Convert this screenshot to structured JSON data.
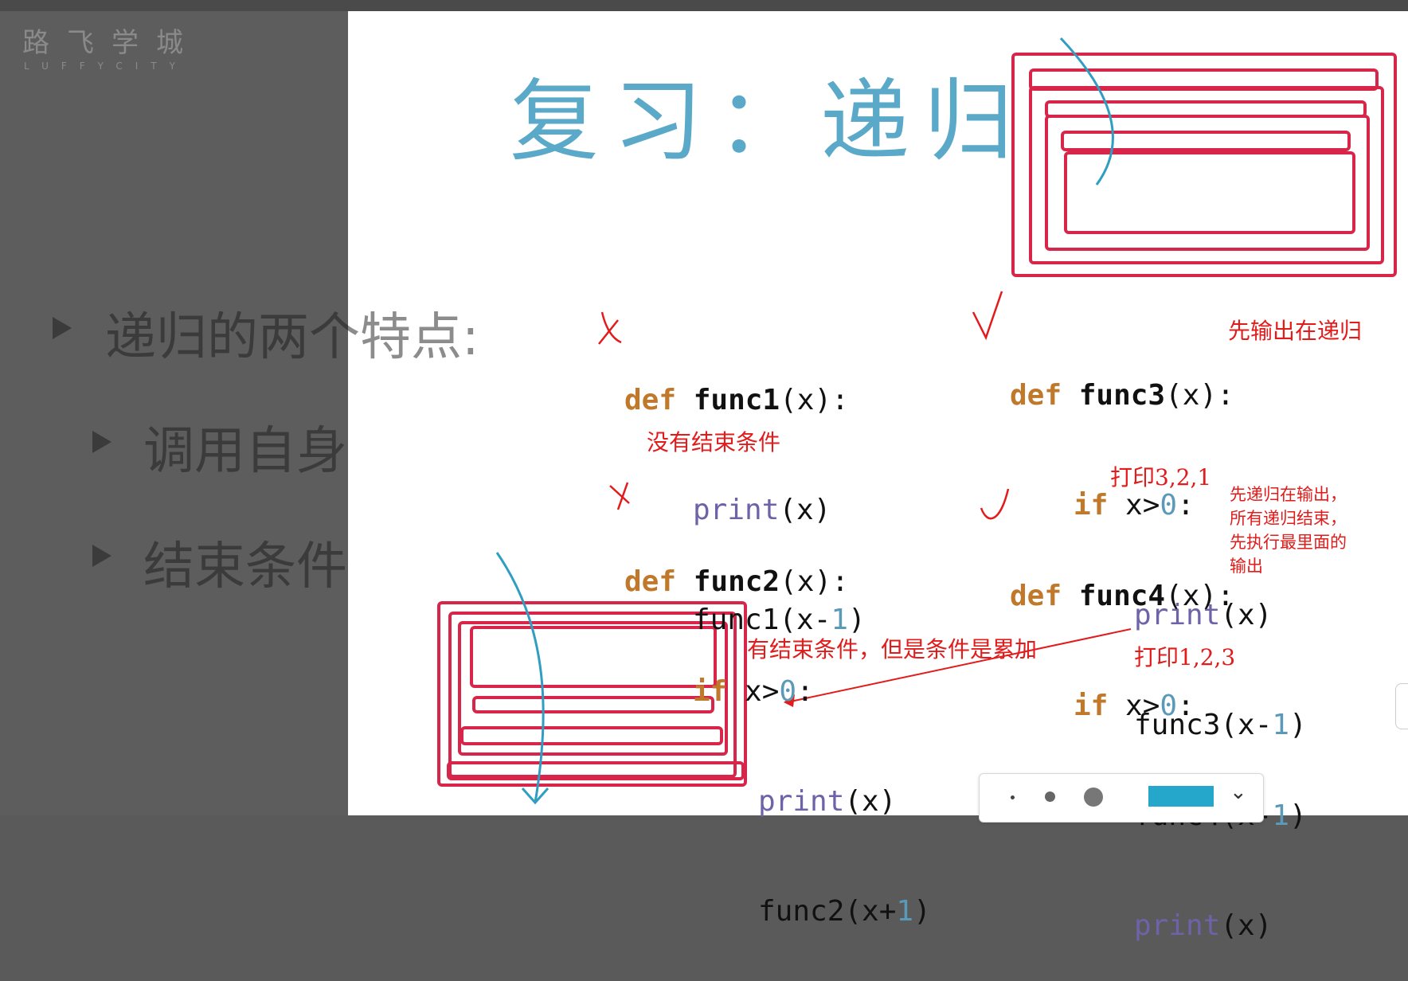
{
  "brand": {
    "chinese": "路飞学城",
    "english": "LUFFYCITY"
  },
  "left_slide": {
    "main_bullet": "递归的两个特点:",
    "sub_bullets": [
      "调用自身",
      "结束条件"
    ]
  },
  "whiteboard": {
    "title": "复习：递归",
    "func1": {
      "mark": "X",
      "line1": {
        "kw": "def",
        "name": "func1",
        "rest": "(x):"
      },
      "line2": {
        "call": "print",
        "rest": "(x)"
      },
      "line3": {
        "pre": "func1(x-",
        "num": "1",
        "post": ")"
      },
      "note": "没有结束条件"
    },
    "func2": {
      "mark": "X",
      "line1": {
        "kw": "def",
        "name": "func2",
        "rest": "(x):"
      },
      "line2": {
        "kw": "if",
        "pre": " x>",
        "num": "0",
        "post": ":"
      },
      "line3": {
        "call": "print",
        "rest": "(x)"
      },
      "line4": {
        "pre": "func2(x+",
        "num": "1",
        "post": ")"
      },
      "note": "有结束条件，但是条件是累加"
    },
    "func3": {
      "mark": "√",
      "line1": {
        "kw": "def",
        "name": "func3",
        "rest": "(x):"
      },
      "line2": {
        "kw": "if",
        "pre": " x>",
        "num": "0",
        "post": ":"
      },
      "line3": {
        "call": "print",
        "rest": "(x)"
      },
      "line4": {
        "pre": "func3(x-",
        "num": "1",
        "post": ")"
      },
      "note_side": "先输出在递归",
      "note_below": "打印3,2,1"
    },
    "func4": {
      "mark": "√",
      "line1": {
        "kw": "def",
        "name": "func4",
        "rest": "(x):"
      },
      "line2": {
        "kw": "if",
        "pre": " x>",
        "num": "0",
        "post": ":"
      },
      "line3": {
        "pre": "func4(x-",
        "num": "1",
        "post": ")"
      },
      "line4": {
        "call": "print",
        "rest": "(x)"
      },
      "note_side": "先递归在输出，\n所有递归结束，\n先执行最里面的\n输出",
      "note_below": "打印1,2,3"
    }
  },
  "pen_toolbar": {
    "sizes": [
      "small-dot",
      "medium-dot",
      "large-dot"
    ],
    "selected_color": "#25a7cc",
    "dropdown_icon": "chevron-down-icon"
  },
  "colors": {
    "title": "#5aa9c9",
    "annotation": "#e21b1b",
    "drawing_boxes": "#d7264a",
    "drawing_stroke": "#2f9ec0"
  }
}
